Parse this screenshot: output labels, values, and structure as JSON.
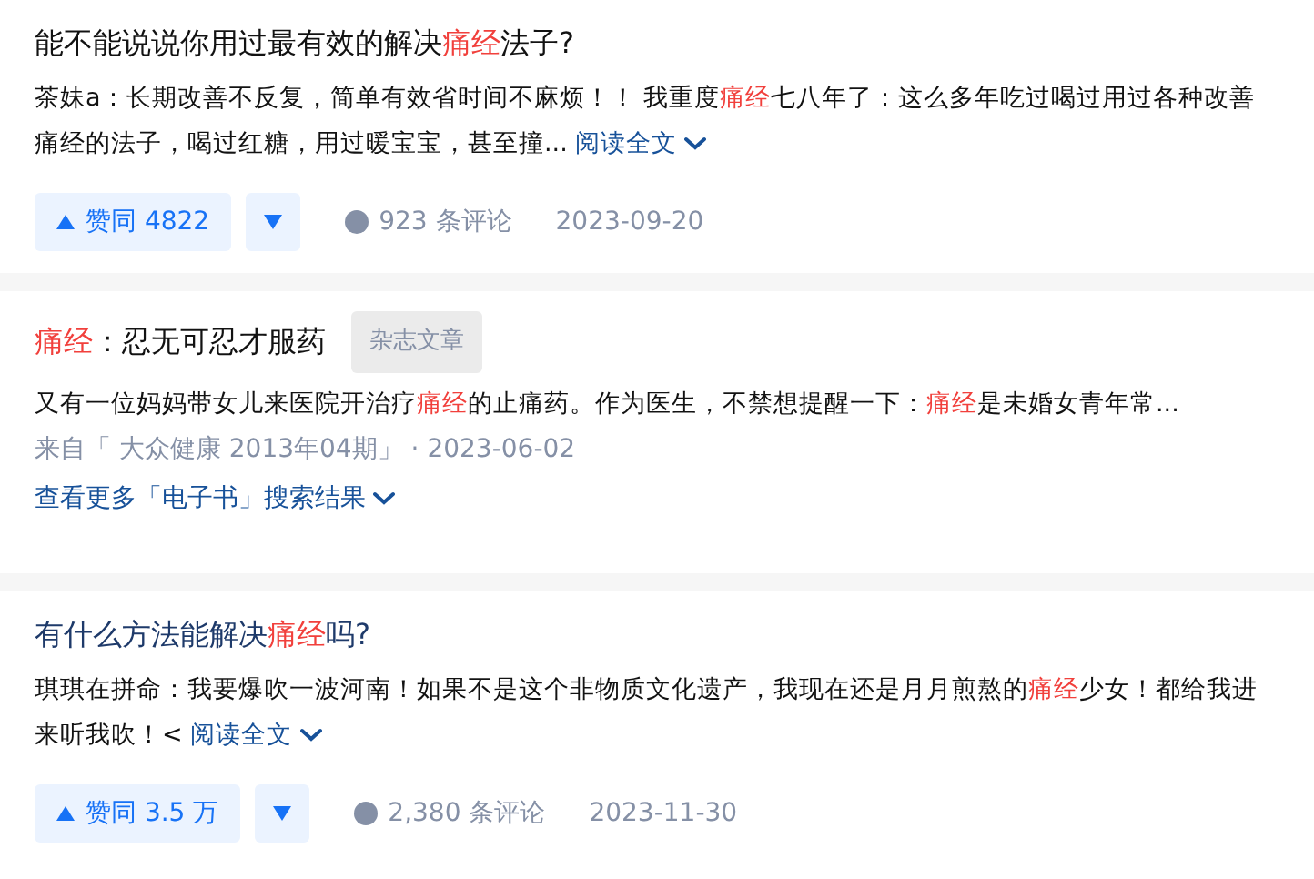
{
  "results": [
    {
      "kind": "answer",
      "title": [
        {
          "text": "能不能说说你用过最有效的解决",
          "highlight": false
        },
        {
          "text": "痛经",
          "highlight": true
        },
        {
          "text": "法子?",
          "highlight": false
        }
      ],
      "visited": false,
      "excerpt": [
        {
          "text": "茶妹a：长期改善不反复，简单有效省时间不麻烦！！ 我重度",
          "highlight": false
        },
        {
          "text": "痛经",
          "highlight": true
        },
        {
          "text": "七八年了：这么多年吃过喝过用过各种改善痛经的法子，喝过红糖，用过暖宝宝，甚至撞...",
          "highlight": false
        }
      ],
      "read_more": "阅读全文",
      "upvote": "赞同 4822",
      "comments": "923 条评论",
      "date": "2023-09-20"
    },
    {
      "kind": "magazine",
      "title": [
        {
          "text": "痛经",
          "highlight": true
        },
        {
          "text": "：忍无可忍才服药",
          "highlight": false
        }
      ],
      "visited": false,
      "tag": "杂志文章",
      "excerpt": [
        {
          "text": "又有一位妈妈带女儿来医院开治疗",
          "highlight": false
        },
        {
          "text": "痛经",
          "highlight": true
        },
        {
          "text": "的止痛药。作为医生，不禁想提醒一下：",
          "highlight": false
        },
        {
          "text": "痛经",
          "highlight": true
        },
        {
          "text": "是未婚女青年常...",
          "highlight": false
        }
      ],
      "source": "来自「 大众健康 2013年04期」",
      "separator": "·",
      "date": "2023-06-02",
      "more": "查看更多「电子书」搜索结果"
    },
    {
      "kind": "answer",
      "title": [
        {
          "text": "有什么方法能解决",
          "highlight": false
        },
        {
          "text": "痛经",
          "highlight": true
        },
        {
          "text": "吗?",
          "highlight": false
        }
      ],
      "visited": true,
      "excerpt": [
        {
          "text": "琪琪在拼命：我要爆吹一波河南！如果不是这个非物质文化遗产，我现在还是月月煎熬的",
          "highlight": false
        },
        {
          "text": "痛经",
          "highlight": true
        },
        {
          "text": "少女！都给我进来听我吹！<",
          "highlight": false
        }
      ],
      "read_more": "阅读全文",
      "upvote": "赞同 3.5 万",
      "comments": "2,380 条评论",
      "date": "2023-11-30"
    }
  ]
}
